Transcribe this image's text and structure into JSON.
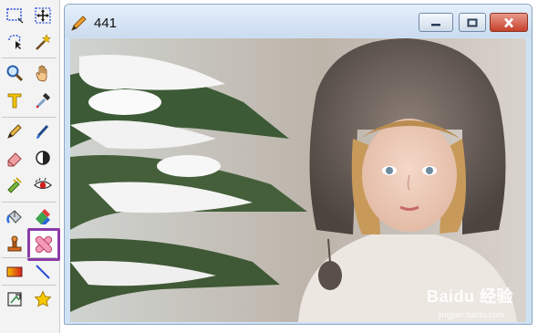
{
  "window": {
    "title": "441"
  },
  "watermark": {
    "brand": "Baidu 经验",
    "url": "jingyan.baidu.com"
  },
  "tools": [
    {
      "name": "rect-select",
      "icon": "rectangle-select-icon"
    },
    {
      "name": "move-selection",
      "icon": "move-icon"
    },
    {
      "name": "lasso-select",
      "icon": "lasso-icon"
    },
    {
      "name": "magic-wand",
      "icon": "magic-wand-icon"
    },
    {
      "name": "zoom",
      "icon": "magnifier-icon"
    },
    {
      "name": "hand",
      "icon": "hand-icon"
    },
    {
      "name": "text",
      "icon": "text-tool-icon"
    },
    {
      "name": "color-picker",
      "icon": "eyedropper-icon"
    },
    {
      "name": "pencil",
      "icon": "pencil-icon"
    },
    {
      "name": "brush",
      "icon": "brush-icon"
    },
    {
      "name": "eraser",
      "icon": "eraser-icon"
    },
    {
      "name": "contrast",
      "icon": "contrast-icon"
    },
    {
      "name": "clone",
      "icon": "clone-stamp-icon"
    },
    {
      "name": "red-eye",
      "icon": "red-eye-icon"
    },
    {
      "name": "fill",
      "icon": "paint-bucket-icon"
    },
    {
      "name": "color-replace",
      "icon": "color-replace-icon"
    },
    {
      "name": "stamp",
      "icon": "stamp-icon"
    },
    {
      "name": "heal",
      "icon": "bandage-icon"
    },
    {
      "name": "gradient",
      "icon": "gradient-icon"
    },
    {
      "name": "line",
      "icon": "line-icon"
    },
    {
      "name": "transform",
      "icon": "transform-icon"
    },
    {
      "name": "star",
      "icon": "star-icon"
    }
  ],
  "active_tool": "heal"
}
